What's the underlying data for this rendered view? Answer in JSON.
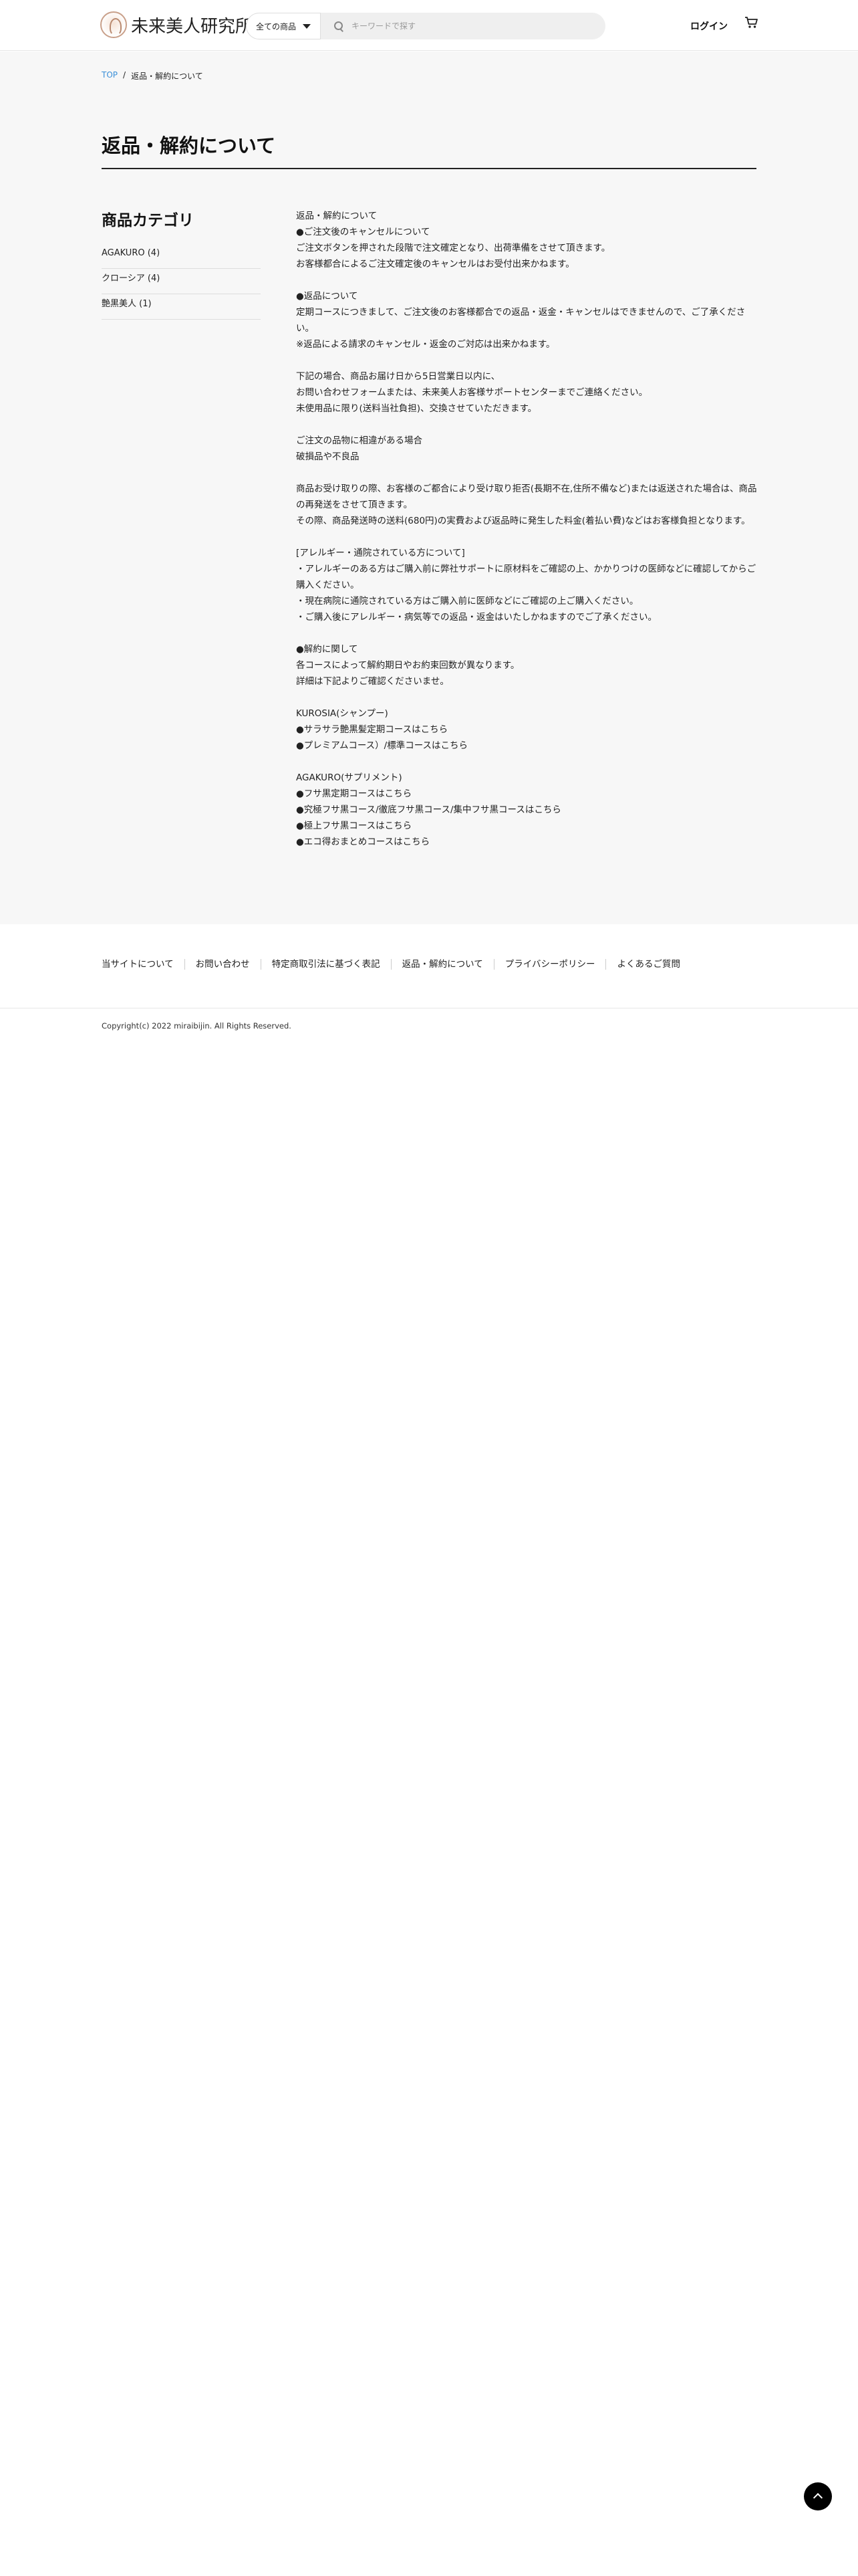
{
  "header": {
    "logo_text": "未来美人研究所",
    "search_category": "全ての商品",
    "search_placeholder": "キーワードで探す",
    "login_label": "ログイン"
  },
  "breadcrumb": {
    "top": "TOP",
    "separator": "/",
    "current": "返品・解約について"
  },
  "page_title": "返品・解約について",
  "sidebar": {
    "heading": "商品カテゴリ",
    "items": [
      {
        "label": "AGAKURO (4)"
      },
      {
        "label": "クローシア (4)"
      },
      {
        "label": "艶黒美人 (1)"
      }
    ]
  },
  "content": {
    "blocks": [
      [
        "返品・解約について",
        "●ご注文後のキャンセルについて",
        "ご注文ボタンを押された段階で注文確定となり、出荷準備をさせて頂きます。",
        "お客様都合によるご注文確定後のキャンセルはお受付出来かねます。"
      ],
      [
        "●返品について",
        "定期コースにつきまして、ご注文後のお客様都合での返品・返金・キャンセルはできませんので、ご了承ください。",
        "※返品による請求のキャンセル・返金のご対応は出来かねます。"
      ],
      [
        "下記の場合、商品お届け日から5日営業日以内に、",
        "お問い合わせフォームまたは、未来美人お客様サポートセンターまでご連絡ください。",
        "未使用品に限り(送料当社負担)、交換させていただきます。"
      ],
      [
        "ご注文の品物に相違がある場合",
        "破損品や不良品"
      ],
      [
        "商品お受け取りの際、お客様のご都合により受け取り拒否(長期不在,住所不備など)または返送された場合は、商品の再発送をさせて頂きます。",
        "その際、商品発送時の送料(680円)の実費および返品時に発生した料金(着払い費)などはお客様負担となります。"
      ],
      [
        "[アレルギー・通院されている方について]",
        "・アレルギーのある方はご購入前に弊社サポートに原材料をご確認の上、かかりつけの医師などに確認してからご購入ください。",
        "・現在病院に通院されている方はご購入前に医師などにご確認の上ご購入ください。",
        "・ご購入後にアレルギー・病気等での返品・返金はいたしかねますのでご了承ください。"
      ],
      [
        "●解約に関して",
        "各コースによって解約期日やお約束回数が異なります。",
        "詳細は下記よりご確認くださいませ。"
      ],
      [
        "KUROSIA(シャンプー)",
        "●サラサラ艶黒髪定期コースはこちら",
        "●プレミアムコース）/標準コースはこちら"
      ],
      [
        "AGAKURO(サプリメント)",
        "●フサ黒定期コースはこちら",
        "●究極フサ黒コース/徹底フサ黒コース/集中フサ黒コースはこちら",
        "●極上フサ黒コースはこちら",
        "●エコ得おまとめコースはこちら"
      ]
    ]
  },
  "footer": {
    "links": [
      "当サイトについて",
      "お問い合わせ",
      "特定商取引法に基づく表記",
      "返品・解約について",
      "プライバシーポリシー",
      "よくあるご質問"
    ],
    "copyright": "Copyright(c) 2022 miraibijin. All Rights Reserved."
  }
}
